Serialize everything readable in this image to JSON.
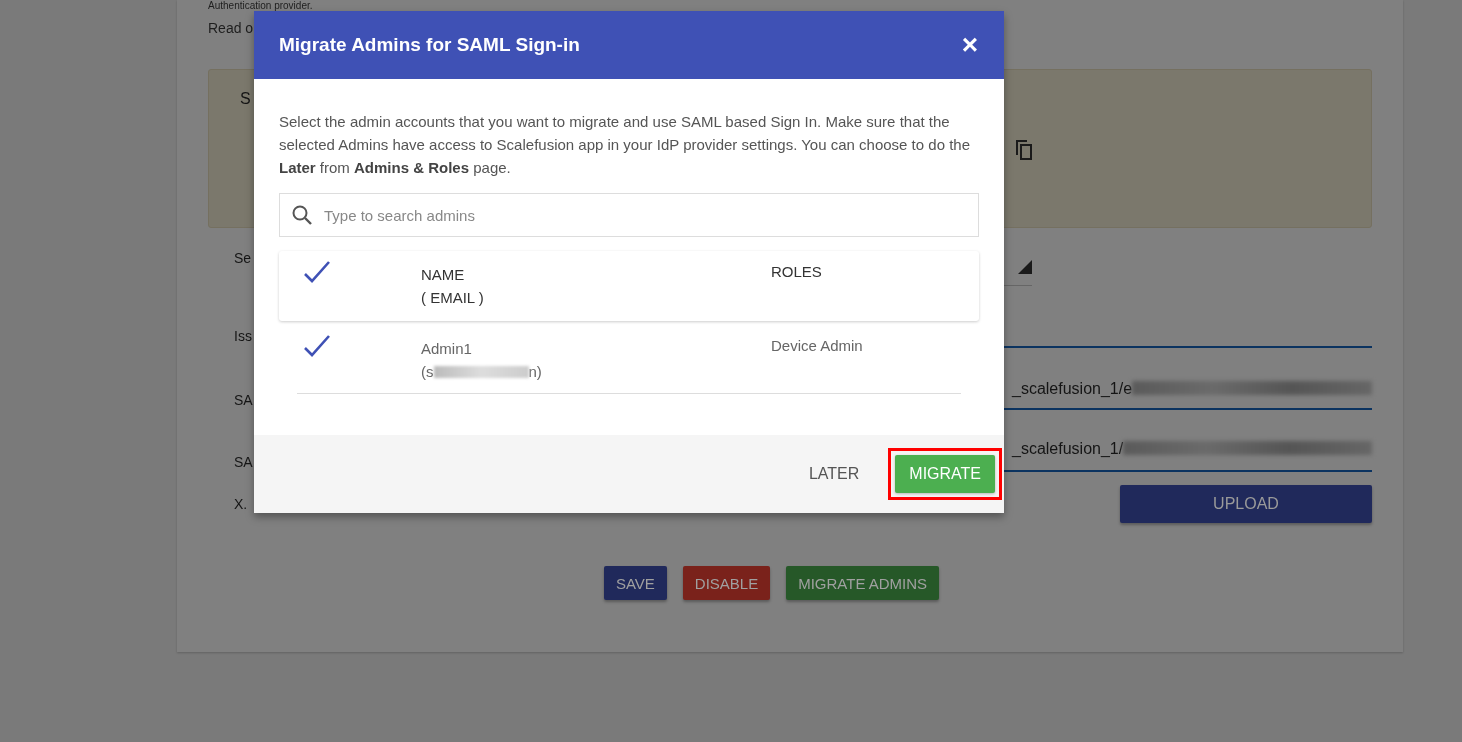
{
  "page": {
    "intro": "Authentication provider.",
    "read_more": "Read o",
    "info_box": {
      "label": "S"
    },
    "form": [
      {
        "kind": "select",
        "label": "Se"
      },
      {
        "kind": "text",
        "label": "Iss"
      },
      {
        "kind": "text",
        "label": "SA",
        "value": "_scalefusion_1/e"
      },
      {
        "kind": "text",
        "label": "SA",
        "value": "_scalefusion_1/"
      },
      {
        "kind": "upload",
        "label": "X.",
        "button": "UPLOAD"
      }
    ],
    "buttons": [
      {
        "kind": "save",
        "label": "SAVE"
      },
      {
        "kind": "disable",
        "label": "DISABLE"
      },
      {
        "kind": "migrate",
        "label": "MIGRATE ADMINS"
      }
    ]
  },
  "dialog": {
    "title": "Migrate Admins for SAML Sign-in",
    "close": "×",
    "description": "Select the admin accounts that you want to migrate and use SAML based Sign In. Make sure that the selected Admins have access to Scalefusion app in your IdP provider settings. You can choose to do the **Later** from **Admins & Roles** page.",
    "search": {
      "placeholder": "Type to search admins"
    },
    "table": {
      "columns": [
        "NAME",
        "( EMAIL )",
        "ROLES"
      ],
      "all_selected": true,
      "rows": [
        {
          "name": "Admin1",
          "email_start": "(s",
          "email_end": "n)",
          "role": "Device Admin",
          "selected": true
        }
      ]
    },
    "footer": [
      {
        "kind": "flat",
        "label": "LATER",
        "highlighted": false
      },
      {
        "kind": "primary",
        "label": "MIGRATE",
        "highlighted": true
      }
    ]
  }
}
